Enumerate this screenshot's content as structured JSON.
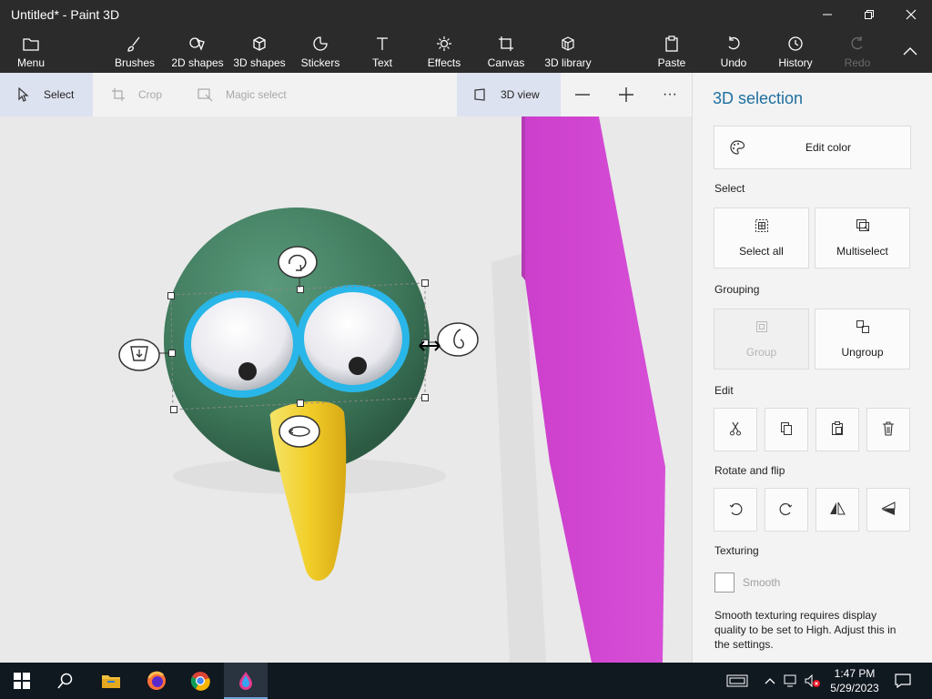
{
  "window": {
    "title": "Untitled* - Paint 3D"
  },
  "toolbar": {
    "menu": "Menu",
    "brushes": "Brushes",
    "shapes2d": "2D shapes",
    "shapes3d": "3D shapes",
    "stickers": "Stickers",
    "text": "Text",
    "effects": "Effects",
    "canvas": "Canvas",
    "library3d": "3D library",
    "paste": "Paste",
    "undo": "Undo",
    "history": "History",
    "redo": "Redo"
  },
  "subbar": {
    "select": "Select",
    "crop": "Crop",
    "magic_select": "Magic select",
    "view3d": "3D view",
    "zoom_out": "—",
    "zoom_in": "+",
    "more": "···"
  },
  "panel": {
    "title": "3D selection",
    "edit_color": "Edit color",
    "select_label": "Select",
    "select_all": "Select all",
    "multiselect": "Multiselect",
    "grouping_label": "Grouping",
    "group": "Group",
    "ungroup": "Ungroup",
    "edit_label": "Edit",
    "rotate_label": "Rotate and flip",
    "texturing_label": "Texturing",
    "smooth": "Smooth",
    "smooth_note": "Smooth texturing requires display quality to be set to High. Adjust this in the settings."
  },
  "taskbar": {
    "time": "1:47 PM",
    "date": "5/29/2023"
  },
  "colors": {
    "accent": "#1e6f9f",
    "magenta": "#d147d1",
    "head": "#3f7a5e",
    "beak": "#f2cf2a",
    "ring": "#2ab7e6"
  }
}
